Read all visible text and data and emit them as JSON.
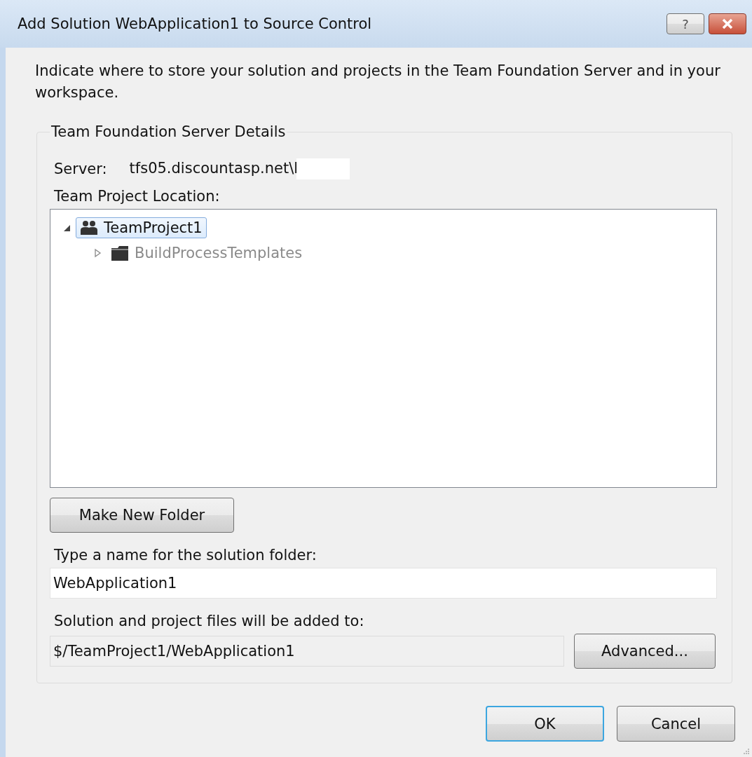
{
  "window": {
    "title": "Add Solution WebApplication1 to Source Control",
    "help_button": "?"
  },
  "description": "Indicate where to store your solution and projects in the Team Foundation Server and in your workspace.",
  "group": {
    "title": "Team Foundation Server Details",
    "server_label": "Server:",
    "server_value": "tfs05.discountasp.net\\l",
    "location_label": "Team Project Location:",
    "tree": [
      {
        "label": "TeamProject1",
        "kind": "project",
        "expanded": true,
        "selected": true,
        "disabled": false,
        "children": [
          {
            "label": "BuildProcessTemplates",
            "kind": "folder",
            "expanded": false,
            "selected": false,
            "disabled": true
          }
        ]
      }
    ],
    "new_folder_button": "Make New Folder",
    "name_label": "Type a name for the solution folder:",
    "name_value": "WebApplication1",
    "path_label": "Solution and project files will be added to:",
    "path_value": "$/TeamProject1/WebApplication1",
    "advanced_button": "Advanced..."
  },
  "buttons": [
    {
      "label": "OK",
      "default": true
    },
    {
      "label": "Cancel",
      "default": false
    }
  ]
}
